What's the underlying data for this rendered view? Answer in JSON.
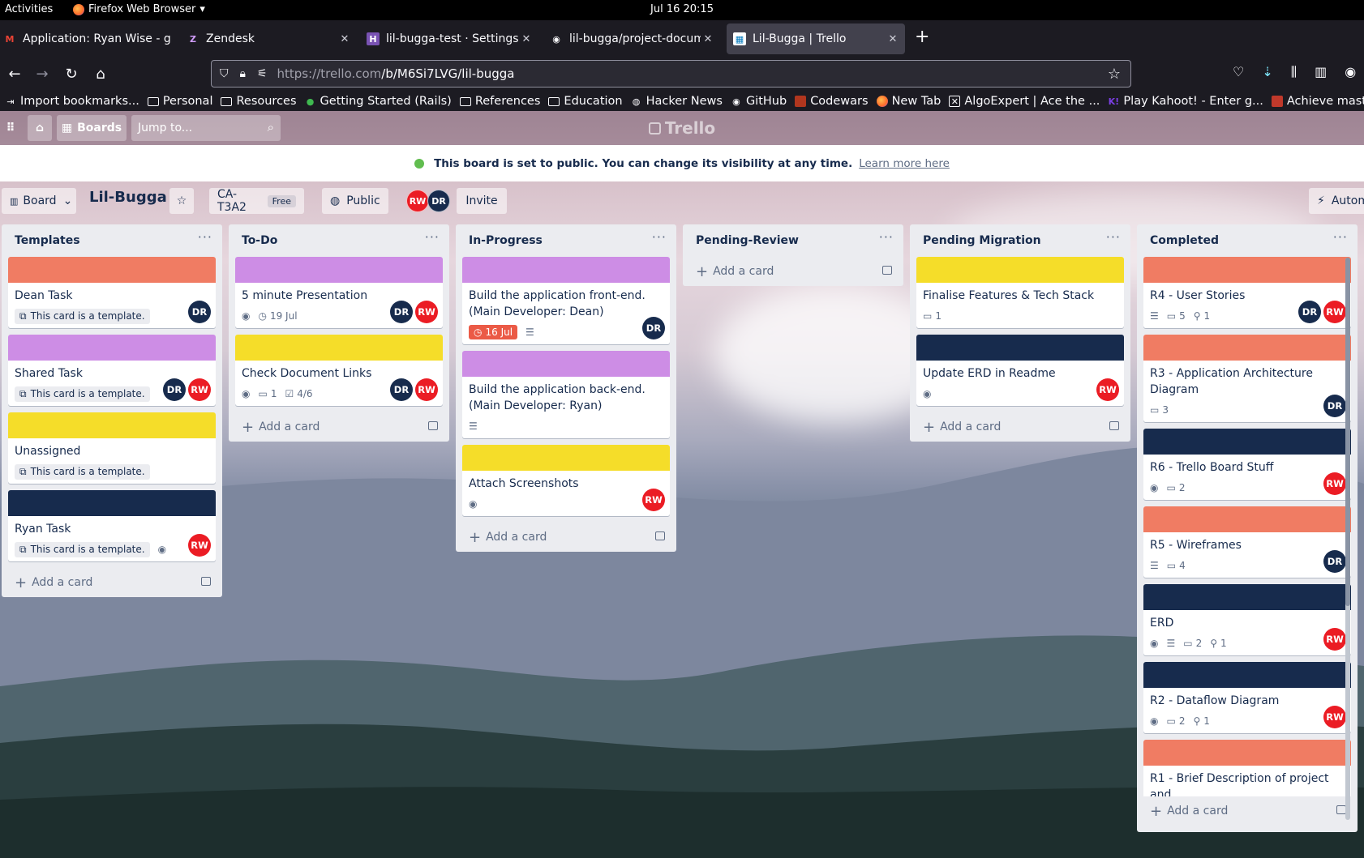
{
  "system": {
    "activities": "Activities",
    "app_name": "Firefox Web Browser",
    "clock": "Jul 16  20:15"
  },
  "browser": {
    "tabs": [
      {
        "title": "Application: Ryan Wise - g",
        "favicon": "M",
        "favicon_color": "#ea4335"
      },
      {
        "title": "Zendesk",
        "favicon": "Z",
        "favicon_color": "#9b59b6"
      },
      {
        "title": "lil-bugga-test · Settings | H",
        "favicon": "H",
        "favicon_color": "#7952b3"
      },
      {
        "title": "lil-bugga/project-docume",
        "favicon": "◉",
        "favicon_color": "#fbfbfe"
      },
      {
        "title": "Lil-Bugga | Trello",
        "favicon": "▦",
        "favicon_color": "#0079bf"
      }
    ],
    "url_host": "https://trello.com",
    "url_path": "/b/M6Si7LVG/lil-bugga",
    "bookmarks": [
      "Import bookmarks...",
      "Personal",
      "Resources",
      "Getting Started (Rails)",
      "References",
      "Education",
      "Hacker News",
      "GitHub",
      "Codewars",
      "New Tab",
      "AlgoExpert | Ace the ...",
      "Play Kahoot! - Enter g...",
      "Achieve mastery thro"
    ]
  },
  "trello": {
    "boards_label": "Boards",
    "jump_placeholder": "Jump to...",
    "logo": "Trello",
    "banner_msg": "This board is set to public. You can change its visibility at any time.",
    "banner_link": "Learn more here",
    "view_label": "Board",
    "board_title": "Lil-Bugga",
    "workspace": "CA-T3A2",
    "workspace_plan": "Free",
    "visibility": "Public",
    "invite": "Invite",
    "automation": "Autom",
    "members": [
      "RW",
      "DR"
    ],
    "add_card": "Add a card",
    "template_badge": "This card is a template.",
    "colors": {
      "orange": "#f07c63",
      "purple": "#cd8de5",
      "yellow": "#f5dd29",
      "navy": "#172b4d",
      "red": "#eb5a46"
    }
  },
  "lists": [
    {
      "title": "Templates",
      "cards": [
        {
          "cover": "orange",
          "title": "Dean Task",
          "template": true,
          "members": [
            "DR"
          ]
        },
        {
          "cover": "purple",
          "title": "Shared Task",
          "template": true,
          "members": [
            "DR",
            "RW"
          ]
        },
        {
          "cover": "yellow",
          "title": "Unassigned",
          "template": true,
          "members": []
        },
        {
          "cover": "navy",
          "title": "Ryan Task",
          "template": true,
          "watch": true,
          "members": [
            "RW"
          ]
        }
      ]
    },
    {
      "title": "To-Do",
      "cards": [
        {
          "cover": "purple",
          "title": "5 minute Presentation",
          "watch": true,
          "due": "19 Jul",
          "members": [
            "DR",
            "RW"
          ]
        },
        {
          "cover": "yellow",
          "title": "Check Document Links",
          "watch": true,
          "comments": "1",
          "checklist": "4/6",
          "members": [
            "DR",
            "RW"
          ]
        }
      ]
    },
    {
      "title": "In-Progress",
      "cards": [
        {
          "cover": "purple",
          "title": "Build the application front-end. (Main Developer: Dean)",
          "due_overdue": "16 Jul",
          "desc": true,
          "members": [
            "DR"
          ]
        },
        {
          "cover": "purple",
          "title": "Build the application back-end. (Main Developer: Ryan)",
          "desc": true,
          "members": []
        },
        {
          "cover": "yellow",
          "title": "Attach Screenshots",
          "watch": true,
          "members": [
            "RW"
          ]
        }
      ]
    },
    {
      "title": "Pending-Review",
      "cards": []
    },
    {
      "title": "Pending Migration",
      "cards": [
        {
          "cover": "yellow",
          "title": "Finalise Features & Tech Stack",
          "comments": "1",
          "members": []
        },
        {
          "cover": "navy",
          "title": "Update ERD in Readme",
          "watch": true,
          "members": [
            "RW"
          ]
        }
      ]
    },
    {
      "title": "Completed",
      "cards": [
        {
          "cover": "orange",
          "title": "R4 - User Stories",
          "desc": true,
          "comments": "5",
          "attachments": "1",
          "members": [
            "DR",
            "RW"
          ]
        },
        {
          "cover": "orange",
          "title": "R3 - Application Architecture Diagram",
          "comments": "3",
          "members": [
            "DR"
          ]
        },
        {
          "cover": "navy",
          "title": "R6 - Trello Board Stuff",
          "watch": true,
          "comments": "2",
          "members": [
            "RW"
          ]
        },
        {
          "cover": "orange",
          "title": "R5 - Wireframes",
          "desc": true,
          "comments": "4",
          "members": [
            "DR"
          ]
        },
        {
          "cover": "navy",
          "title": "ERD",
          "watch": true,
          "desc": true,
          "comments": "2",
          "attachments": "1",
          "members": [
            "RW"
          ]
        },
        {
          "cover": "navy",
          "title": "R2 - Dataflow Diagram",
          "watch": true,
          "comments": "2",
          "attachments": "1",
          "members": [
            "RW"
          ]
        },
        {
          "cover": "orange",
          "title": "R1 - Brief Description of project and",
          "members": []
        }
      ]
    }
  ]
}
